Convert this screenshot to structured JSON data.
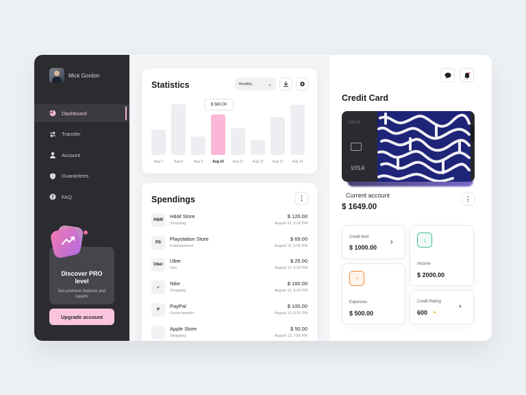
{
  "user": {
    "name": "Mick Gordon"
  },
  "nav": [
    {
      "label": "Dashboard",
      "icon": "pie-chart-icon",
      "active": true
    },
    {
      "label": "Transfer",
      "icon": "transfer-icon",
      "active": false
    },
    {
      "label": "Account",
      "icon": "user-icon",
      "active": false
    },
    {
      "label": "Guarantees",
      "icon": "shield-icon",
      "active": false
    },
    {
      "label": "FAQ",
      "icon": "info-icon",
      "active": false
    }
  ],
  "promo": {
    "title": "Discover PRO level",
    "subtitle": "Get premium features and reports",
    "button": "Upgrade account"
  },
  "statistics": {
    "title": "Statistics",
    "period": "Monthly",
    "tooltip": "$ 560.00",
    "chart_data": {
      "type": "bar",
      "categories": [
        "Aug 7",
        "Aug 8",
        "Aug 9",
        "Aug 10",
        "Aug 11",
        "Aug 12",
        "Aug 13",
        "Aug 14"
      ],
      "values": [
        50,
        100,
        37,
        80,
        53,
        30,
        75,
        98
      ],
      "highlight_index": 3,
      "highlight_color": "#fbb8d6",
      "bar_color": "#eceef1"
    }
  },
  "spendings": {
    "title": "Spendings",
    "items": [
      {
        "name": "H&M Store",
        "category": "Shopping",
        "amount": "$ 120.00",
        "date": "August 12, 6:32 PM",
        "logo": "H&M"
      },
      {
        "name": "Playstation Store",
        "category": "Entertainment",
        "amount": "$ 69.00",
        "date": "August 12, 6:00 PM",
        "logo": "PS"
      },
      {
        "name": "Uber",
        "category": "Taxi",
        "amount": "$ 25.00",
        "date": "August 12, 6:32 PM",
        "logo": "Uber"
      },
      {
        "name": "Nike",
        "category": "Shopping",
        "amount": "$ 160.00",
        "date": "August 12, 6:32 PM",
        "logo": "✓"
      },
      {
        "name": "PayPal",
        "category": "Funds transfer",
        "amount": "$ 100.00",
        "date": "August 13, 9:21 PM",
        "logo": "P"
      },
      {
        "name": "Apple Store",
        "category": "Shopping",
        "amount": "$ 50.00",
        "date": "August 13, 7:00 PM",
        "logo": ""
      }
    ]
  },
  "credit": {
    "title": "Credit Card",
    "card_brand": "Obsidi",
    "card_network": "VISA",
    "account_label": "Current account",
    "account_value": "$ 1649.00",
    "credit_limit_label": "Credit limit",
    "credit_limit_value": "$ 1000.00",
    "income_label": "Income",
    "income_value": "$ 2000.00",
    "expenses_label": "Expences",
    "expenses_value": "$ 500.00",
    "rating_label": "Credit Rating",
    "rating_value": "600",
    "colors": {
      "income": "#3bbf8a",
      "expenses": "#f08a3c",
      "rating_dot": "#f2c230"
    }
  }
}
